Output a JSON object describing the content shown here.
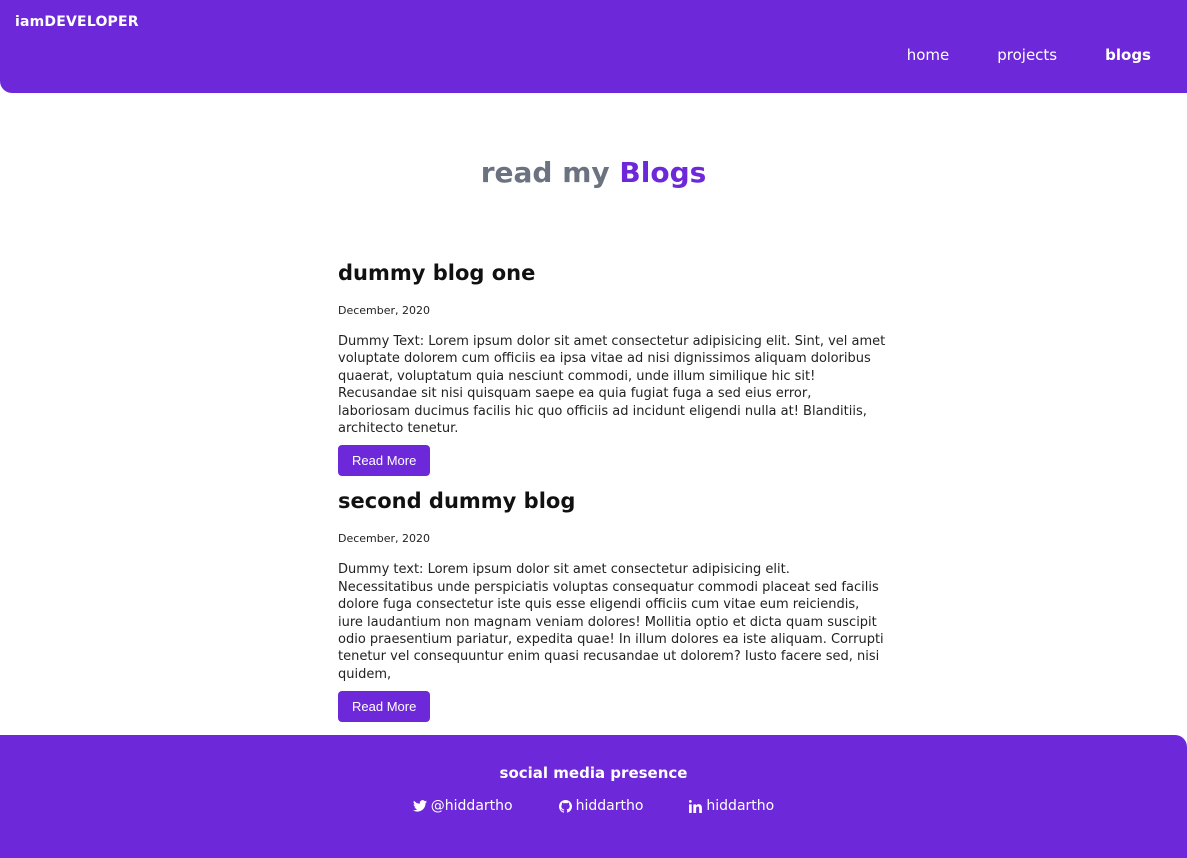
{
  "header": {
    "brand": "iamDEVELOPER",
    "nav": [
      {
        "label": "home"
      },
      {
        "label": "projects"
      },
      {
        "label": "blogs",
        "active": true
      }
    ]
  },
  "section": {
    "title_prefix": "read my",
    "title_accent": "Blogs"
  },
  "posts": [
    {
      "title": "dummy blog one",
      "date": "December, 2020",
      "body": "Dummy Text: Lorem ipsum dolor sit amet consectetur adipisicing elit. Sint, vel amet voluptate dolorem cum officiis ea ipsa vitae ad nisi dignissimos aliquam doloribus quaerat, voluptatum quia nesciunt commodi, unde illum similique hic sit! Recusandae sit nisi quisquam saepe ea quia fugiat fuga a sed eius error, laboriosam ducimus facilis hic quo officiis ad incidunt eligendi nulla at! Blanditiis, architecto tenetur.",
      "button": "Read More"
    },
    {
      "title": "second dummy blog",
      "date": "December, 2020",
      "body": "Dummy text: Lorem ipsum dolor sit amet consectetur adipisicing elit. Necessitatibus unde perspiciatis voluptas consequatur commodi placeat sed facilis dolore fuga consectetur iste quis esse eligendi officiis cum vitae eum reiciendis, iure laudantium non magnam veniam dolores! Mollitia optio et dicta quam suscipit odio praesentium pariatur, expedita quae! In illum dolores ea iste aliquam. Corrupti tenetur vel consequuntur enim quasi recusandae ut dolorem? Iusto facere sed, nisi quidem,",
      "button": "Read More"
    }
  ],
  "footer": {
    "title": "social media presence",
    "socials": [
      {
        "icon": "twitter-icon",
        "label": "@hiddartho"
      },
      {
        "icon": "github-icon",
        "label": "hiddartho"
      },
      {
        "icon": "linkedin-icon",
        "label": "hiddartho"
      }
    ]
  },
  "colors": {
    "accent": "#6d28d9",
    "title_gray": "#6b7280"
  }
}
